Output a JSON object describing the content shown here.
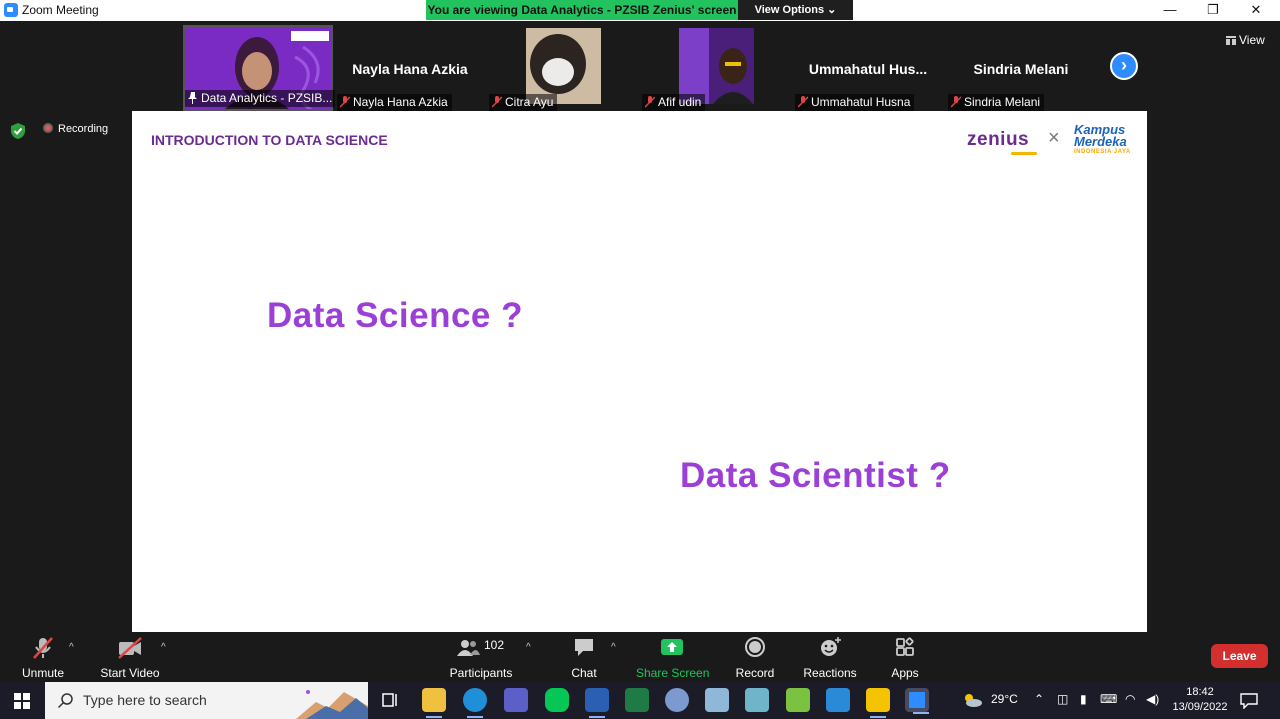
{
  "window": {
    "title": "Zoom Meeting",
    "share_banner": "You are viewing Data Analytics - PZSIB Zenius' screen",
    "view_options": "View Options",
    "view_options_caret": "⌄",
    "minimize": "—",
    "restore": "❐",
    "close": "✕"
  },
  "participants_strip": [
    {
      "label": "Data Analytics - PZSIB...",
      "has_video": true,
      "pinned": true
    },
    {
      "label": "Nayla Hana Azkia",
      "display_name": "Nayla Hana Azkia",
      "has_video": false
    },
    {
      "label": "Citra Ayu",
      "has_video": true
    },
    {
      "label": "Afif udin",
      "has_video": true
    },
    {
      "label": "Ummahatul Husna",
      "display_name": "Ummahatul  Hus...",
      "has_video": false
    },
    {
      "label": "Sindria Melani",
      "display_name": "Sindria Melani",
      "has_video": false
    }
  ],
  "view_label": "View",
  "next_arrow": "›",
  "status": {
    "recording": "Recording"
  },
  "slide": {
    "header": "INTRODUCTION TO DATA SCIENCE",
    "logo_zenius": "zenius",
    "logo_x": "×",
    "logo_km_line1": "Kampus",
    "logo_km_line2": "Merdeka",
    "logo_km_sub": "INDONESIA JAYA",
    "question1": "Data Science ?",
    "question2": "Data Scientist ?"
  },
  "controls": {
    "unmute": "Unmute",
    "start_video": "Start Video",
    "participants": "Participants",
    "participants_count": "102",
    "chat": "Chat",
    "share_screen": "Share Screen",
    "record": "Record",
    "reactions": "Reactions",
    "apps": "Apps",
    "leave": "Leave",
    "caret": "^"
  },
  "taskbar": {
    "search_placeholder": "Type here to search",
    "temperature": "29°C",
    "time": "18:42",
    "date": "13/09/2022"
  },
  "colors": {
    "accent_blue": "#2d8cff",
    "share_green": "#22c35e",
    "slide_purple": "#9b3fd6",
    "header_purple": "#6a2c91",
    "leave_red": "#d32f2f"
  }
}
